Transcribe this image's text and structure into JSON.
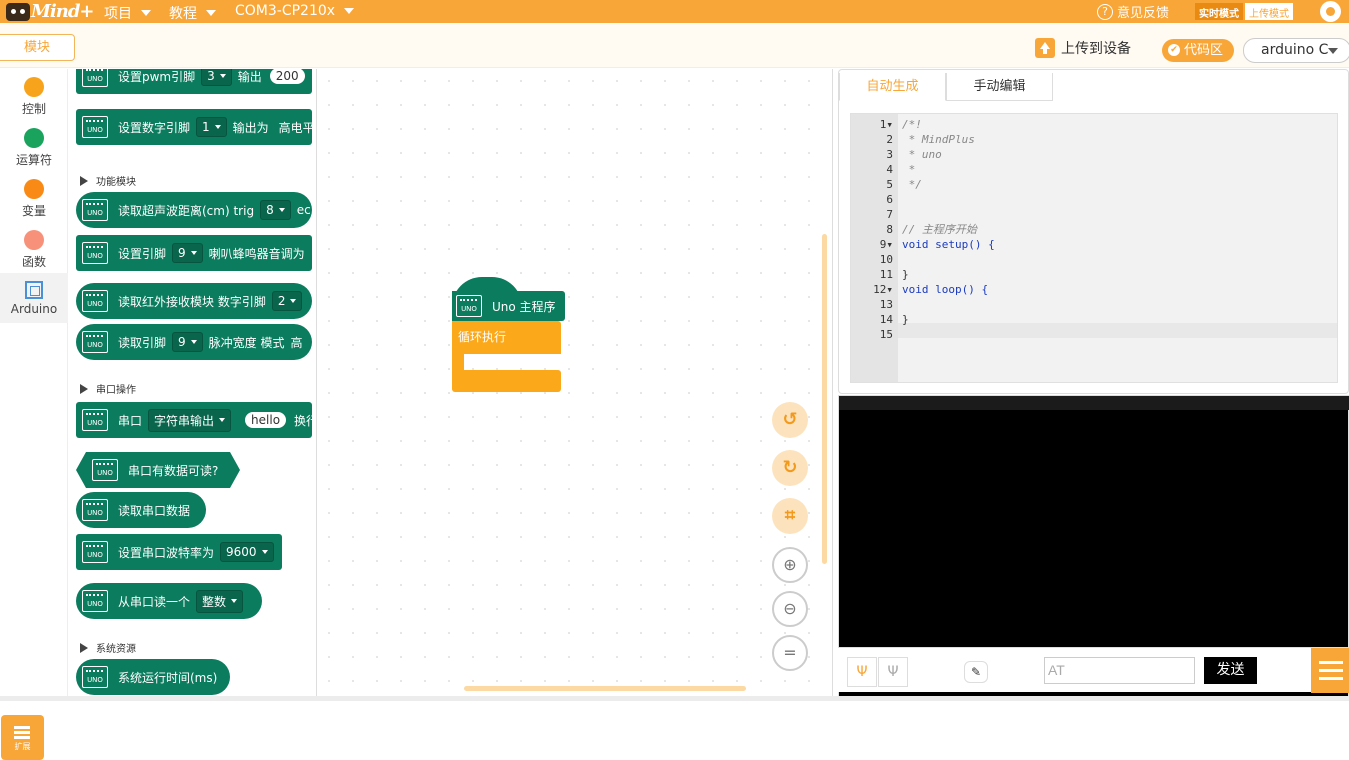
{
  "topbar": {
    "brand": "Mind+",
    "menus": [
      {
        "label": "项目"
      },
      {
        "label": "教程"
      },
      {
        "label": "COM3-CP210x"
      }
    ],
    "feedback": "意见反馈",
    "mode_realtime": "实时模式",
    "mode_upload": "上传模式"
  },
  "subbar": {
    "module_tab": "模块",
    "upload": "上传到设备",
    "code_zone": "代码区",
    "board": "arduino C"
  },
  "categories": [
    {
      "label": "控制",
      "color": "#f7a31c"
    },
    {
      "label": "运算符",
      "color": "#1aa35c"
    },
    {
      "label": "变量",
      "color": "#f88a15"
    },
    {
      "label": "函数",
      "color": "#f7917a"
    },
    {
      "label": "Arduino",
      "color": "#4a90d9"
    }
  ],
  "extension": "扩展",
  "palette": {
    "pwm": {
      "label": "设置pwm引脚",
      "pin": "3",
      "out": "输出",
      "value": "200"
    },
    "digital": {
      "label": "设置数字引脚",
      "pin": "1",
      "out": "输出为",
      "value": "高电平"
    },
    "section_func": "功能模块",
    "ultrasonic": {
      "label": "读取超声波距离(cm) trig",
      "pin": "8",
      "tail": "ec"
    },
    "buzzer": {
      "label": "设置引脚",
      "pin": "9",
      "tail": "喇叭蜂鸣器音调为"
    },
    "ir": {
      "label": "读取红外接收模块 数字引脚",
      "pin": "2"
    },
    "pulse": {
      "label": "读取引脚",
      "pin": "9",
      "tail": "脉冲宽度 模式",
      "tail2": "高"
    },
    "section_serial": "串口操作",
    "serial_out": {
      "label": "串口",
      "mode": "字符串输出",
      "value": "hello",
      "tail": "换行"
    },
    "serial_avail": "串口有数据可读?",
    "serial_read": "读取串口数据",
    "baud": {
      "label": "设置串口波特率为",
      "value": "9600"
    },
    "read_one": {
      "label": "从串口读一个",
      "type": "整数"
    },
    "section_sys": "系统资源",
    "uptime": "系统运行时间(ms)",
    "uno": "UNO"
  },
  "workspace": {
    "hat_label": "Uno 主程序",
    "loop_label": "循环执行",
    "controls": [
      "undo-icon",
      "redo-icon",
      "crop-icon",
      "zoom-in-icon",
      "zoom-out-icon",
      "zoom-reset-icon"
    ]
  },
  "code": {
    "tabs": [
      "自动生成",
      "手动编辑"
    ],
    "lines": [
      "/*!",
      " * MindPlus",
      " * uno",
      " *",
      " */",
      "",
      "",
      "// 主程序开始",
      "void setup() {",
      "",
      "}",
      "void loop() {",
      "",
      "}",
      ""
    ]
  },
  "serial": {
    "input_value": "AT",
    "send": "发送"
  },
  "colors": {
    "accent": "#f8a638",
    "block_green": "#0b7c5e",
    "loop_orange": "#fba81b"
  }
}
